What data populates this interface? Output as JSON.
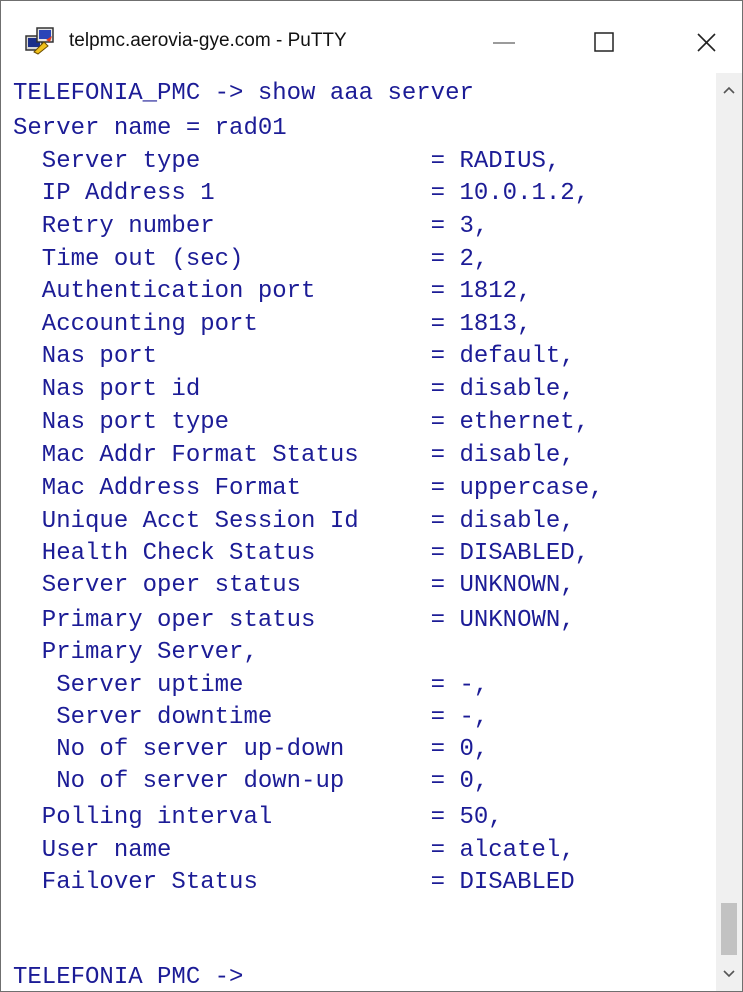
{
  "window": {
    "title": "telpmc.aerovia-gye.com - PuTTY",
    "icon": "putty-icon"
  },
  "controls": {
    "minimize": "minimize-icon",
    "maximize": "maximize-icon",
    "close": "close-icon"
  },
  "terminal": {
    "text_color": "#1c1c96",
    "background": "#ffffff",
    "lines": [
      "TELEFONIA_PMC -> show aaa server",
      "Server name = rad01",
      "  Server type                = RADIUS,",
      "  IP Address 1               = 10.0.1.2,",
      "  Retry number               = 3,",
      "  Time out (sec)             = 2,",
      "  Authentication port        = 1812,",
      "  Accounting port            = 1813,",
      "  Nas port                   = default,",
      "  Nas port id                = disable,",
      "  Nas port type              = ethernet,",
      "  Mac Addr Format Status     = disable,",
      "  Mac Address Format         = uppercase,",
      "  Unique Acct Session Id     = disable,",
      "  Health Check Status        = DISABLED,",
      "  Server oper status         = UNKNOWN,",
      "  Primary oper status        = UNKNOWN,",
      "  Primary Server,",
      "   Server uptime             = -,",
      "   Server downtime           = -,",
      "   No of server up-down      = 0,",
      "   No of server down-up      = 0,",
      "  Polling interval           = 50,",
      "  User name                  = alcatel,",
      "  Failover Status            = DISABLED",
      "",
      "",
      "TELEFONIA PMC ->"
    ]
  },
  "scrollbar": {
    "up": "chevron-up-icon",
    "down": "chevron-down-icon"
  }
}
